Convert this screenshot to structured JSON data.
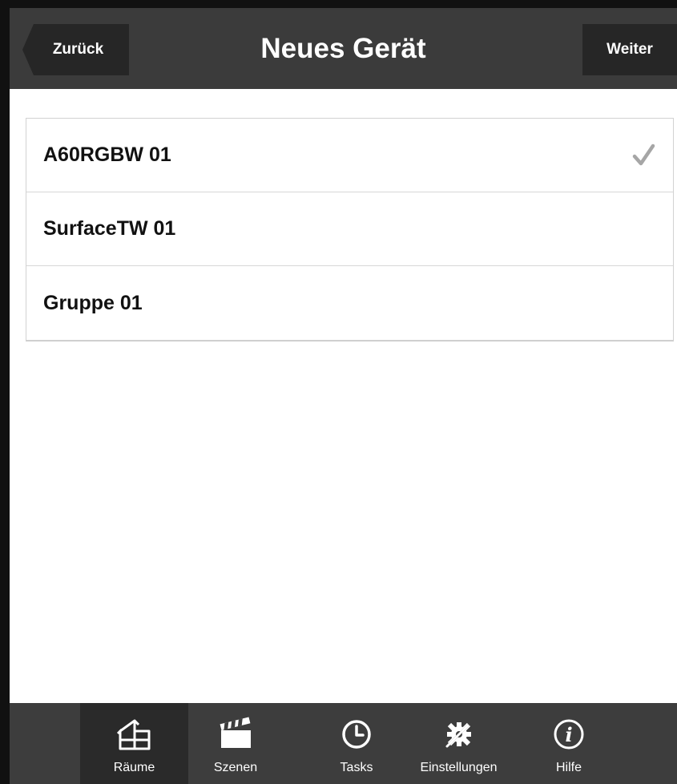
{
  "header": {
    "back_label": "Zurück",
    "title": "Neues Gerät",
    "next_label": "Weiter"
  },
  "devices": [
    {
      "name": "A60RGBW 01",
      "selected": true
    },
    {
      "name": "SurfaceTW 01",
      "selected": false
    },
    {
      "name": "Gruppe 01",
      "selected": false
    }
  ],
  "tabbar": {
    "active": "Räume",
    "tabs": [
      {
        "label": "Räume",
        "icon": "house-icon"
      },
      {
        "label": "Szenen",
        "icon": "clapperboard-icon"
      },
      {
        "label": "Tasks",
        "icon": "clock-icon"
      },
      {
        "label": "Einstellungen",
        "icon": "tools-icon"
      },
      {
        "label": "Hilfe",
        "icon": "info-icon"
      }
    ]
  },
  "colors": {
    "header_bg": "#3b3b3b",
    "button_bg": "#262626",
    "tabbar_bg": "#3d3d3d",
    "active_tab_bg": "#2a2a2a",
    "checkmark": "#a6a6a6"
  }
}
